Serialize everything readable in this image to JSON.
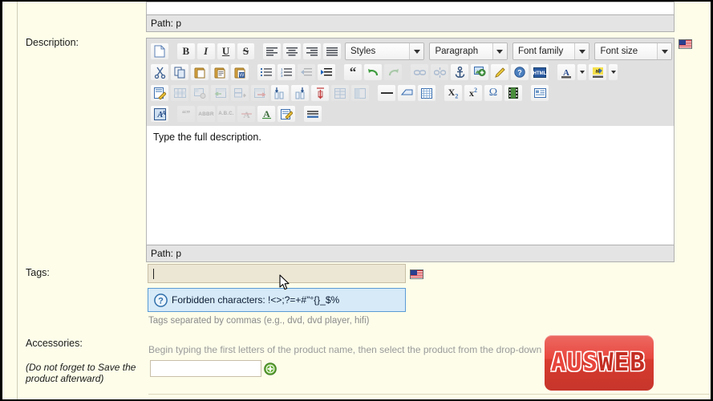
{
  "form": {
    "description_label": "Description:",
    "tags_label": "Tags:",
    "accessories_label": "Accessories:",
    "accessories_note": "(Do not forget to Save the product afterward)"
  },
  "editor": {
    "path_top": "Path: p",
    "path_bottom": "Path: p",
    "content": "Type the full description.",
    "dropdowns": [
      {
        "name": "styles",
        "value": "Styles"
      },
      {
        "name": "format",
        "value": "Paragraph"
      },
      {
        "name": "font-family",
        "value": "Font family"
      },
      {
        "name": "font-size",
        "value": "Font size"
      }
    ],
    "toolbar_row1": [
      {
        "icon": "new-document-icon",
        "label": "",
        "disabled": false
      },
      {
        "icon": "bold-icon",
        "label": "B",
        "disabled": false
      },
      {
        "icon": "italic-icon",
        "label": "I",
        "disabled": false
      },
      {
        "icon": "underline-icon",
        "label": "U",
        "disabled": false
      },
      {
        "icon": "strikethrough-icon",
        "label": "S",
        "disabled": false
      },
      {
        "icon": "align-left-icon",
        "label": "",
        "disabled": false
      },
      {
        "icon": "align-center-icon",
        "label": "",
        "disabled": false
      },
      {
        "icon": "align-right-icon",
        "label": "",
        "disabled": false
      },
      {
        "icon": "align-justify-icon",
        "label": "",
        "disabled": false
      }
    ],
    "toolbar_row2": [
      {
        "icon": "cut-icon",
        "disabled": false
      },
      {
        "icon": "copy-icon",
        "disabled": false
      },
      {
        "icon": "paste-icon",
        "disabled": false
      },
      {
        "icon": "paste-text-icon",
        "disabled": false
      },
      {
        "icon": "paste-word-icon",
        "disabled": false
      },
      {
        "icon": "bullet-list-icon",
        "disabled": false
      },
      {
        "icon": "numbered-list-icon",
        "disabled": false
      },
      {
        "icon": "outdent-icon",
        "disabled": true
      },
      {
        "icon": "indent-icon",
        "disabled": false
      },
      {
        "icon": "blockquote-icon",
        "disabled": false
      },
      {
        "icon": "undo-icon",
        "disabled": false
      },
      {
        "icon": "redo-icon",
        "disabled": true
      },
      {
        "icon": "link-icon",
        "disabled": true
      },
      {
        "icon": "unlink-icon",
        "disabled": true
      },
      {
        "icon": "anchor-icon",
        "disabled": false
      },
      {
        "icon": "insert-image-icon",
        "disabled": false
      },
      {
        "icon": "cleanup-icon",
        "disabled": false
      },
      {
        "icon": "help-icon",
        "disabled": false
      },
      {
        "icon": "html-source-icon",
        "disabled": false
      },
      {
        "icon": "text-color-icon",
        "disabled": false
      },
      {
        "icon": "background-color-icon",
        "disabled": false
      }
    ],
    "toolbar_row3": [
      {
        "icon": "table-properties-icon",
        "disabled": false
      },
      {
        "icon": "table-row-properties-icon",
        "disabled": true
      },
      {
        "icon": "table-cell-properties-icon",
        "disabled": true
      },
      {
        "icon": "insert-row-before-icon",
        "disabled": true
      },
      {
        "icon": "insert-row-after-icon",
        "disabled": true
      },
      {
        "icon": "delete-row-icon",
        "disabled": true
      },
      {
        "icon": "insert-column-before-icon",
        "disabled": false
      },
      {
        "icon": "insert-column-after-icon",
        "disabled": false
      },
      {
        "icon": "delete-column-icon",
        "disabled": false
      },
      {
        "icon": "split-cells-icon",
        "disabled": true
      },
      {
        "icon": "merge-cells-icon",
        "disabled": true
      },
      {
        "icon": "horizontal-rule-icon",
        "disabled": false
      },
      {
        "icon": "remove-format-icon",
        "disabled": false
      },
      {
        "icon": "toggle-guidelines-icon",
        "disabled": false
      },
      {
        "icon": "subscript-icon",
        "disabled": false
      },
      {
        "icon": "superscript-icon",
        "disabled": false
      },
      {
        "icon": "special-character-icon",
        "disabled": false
      },
      {
        "icon": "insert-media-icon",
        "disabled": false
      },
      {
        "icon": "insert-layer-icon",
        "disabled": false
      }
    ],
    "toolbar_row4": [
      {
        "icon": "style-props-icon",
        "disabled": false
      },
      {
        "icon": "citation-icon",
        "disabled": true
      },
      {
        "icon": "abbreviation-icon",
        "disabled": true
      },
      {
        "icon": "acronym-icon",
        "disabled": true
      },
      {
        "icon": "delete-text-icon",
        "disabled": true
      },
      {
        "icon": "insert-text-icon",
        "disabled": false
      },
      {
        "icon": "attributes-icon",
        "disabled": false
      },
      {
        "icon": "insert-date-icon",
        "disabled": false
      }
    ]
  },
  "tags": {
    "value": "",
    "tooltip_text": "Forbidden characters: !<>;?=+#\"°{}_$%",
    "tooltip_icon": "question-mark-icon",
    "hint": "Tags separated by commas (e.g., dvd, dvd player, hifi)"
  },
  "accessories": {
    "instruction": "Begin typing the first letters of the product name, then select the product from the drop-down list:",
    "input_value": "",
    "add_icon": "add-plus-icon"
  },
  "icons": {
    "language_flag": "us-flag-icon",
    "mouse_pointer": "mouse-cursor-icon"
  },
  "branding": {
    "logo_part1": "AUS",
    "logo_part2": "WEB"
  },
  "colors": {
    "page_background": "#fdfdea",
    "toolbar_background": "#e0e0e0",
    "tooltip_background": "#d6eaf8",
    "tooltip_border": "#5b9bd5",
    "tags_input_background": "#ece6d4",
    "logo_red": "#e8453c"
  }
}
